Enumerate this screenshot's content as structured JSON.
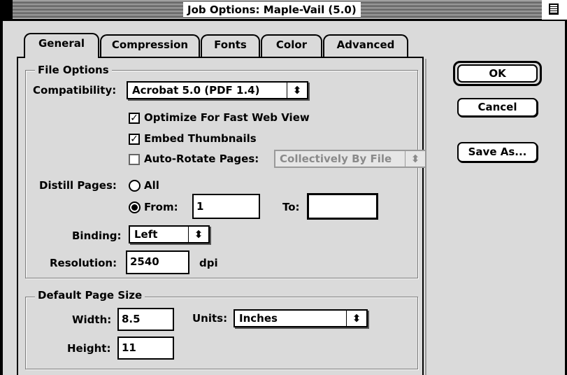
{
  "window": {
    "title": "Job Options: Maple-Vail (5.0)"
  },
  "tabs": [
    {
      "label": "General",
      "active": true
    },
    {
      "label": "Compression",
      "active": false
    },
    {
      "label": "Fonts",
      "active": false
    },
    {
      "label": "Color",
      "active": false
    },
    {
      "label": "Advanced",
      "active": false
    }
  ],
  "file_options": {
    "legend": "File Options",
    "compatibility_label": "Compatibility:",
    "compatibility_value": "Acrobat 5.0 (PDF 1.4)",
    "optimize_label": "Optimize For Fast Web View",
    "optimize_checked": true,
    "embed_thumbnails_label": "Embed Thumbnails",
    "embed_thumbnails_checked": true,
    "auto_rotate_label": "Auto-Rotate Pages:",
    "auto_rotate_checked": false,
    "auto_rotate_value": "Collectively By File",
    "distill_label": "Distill Pages:",
    "all_label": "All",
    "all_selected": false,
    "from_label": "From:",
    "from_selected": true,
    "from_value": "1",
    "to_label": "To:",
    "to_value": "",
    "binding_label": "Binding:",
    "binding_value": "Left",
    "resolution_label": "Resolution:",
    "resolution_value": "2540",
    "resolution_unit": "dpi"
  },
  "page_size": {
    "legend": "Default Page Size",
    "width_label": "Width:",
    "width_value": "8.5",
    "units_label": "Units:",
    "units_value": "Inches",
    "height_label": "Height:",
    "height_value": "11"
  },
  "buttons": {
    "ok": "OK",
    "cancel": "Cancel",
    "save_as": "Save As..."
  },
  "icons": {
    "check": "check-mark",
    "popup_arrows": "up-down-arrows",
    "collapse": "window-collapse-box"
  }
}
